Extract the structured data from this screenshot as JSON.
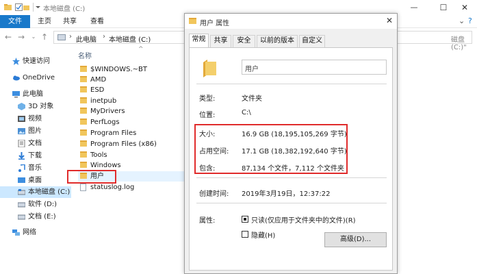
{
  "explorer": {
    "title": "本地磁盘 (C:)",
    "ribbon": {
      "file": "文件",
      "home": "主页",
      "share": "共享",
      "view": "查看"
    },
    "address": {
      "pc": "此电脑",
      "drive": "本地磁盘 (C:)",
      "search_placeholder": "磁盘 (C:)\""
    },
    "nav": {
      "quick_access": "快速访问",
      "onedrive": "OneDrive",
      "this_pc": "此电脑",
      "objects3d": "3D 对象",
      "videos": "视频",
      "pictures": "图片",
      "documents": "文档",
      "downloads": "下载",
      "music": "音乐",
      "desktop": "桌面",
      "drive_c": "本地磁盘 (C:)",
      "drive_d": "软件 (D:)",
      "drive_e": "文档 (E:)",
      "network": "网络"
    },
    "list": {
      "column_name": "名称",
      "items": [
        "$WINDOWS.~BT",
        "AMD",
        "ESD",
        "inetpub",
        "MyDrivers",
        "PerfLogs",
        "Program Files",
        "Program Files (x86)",
        "Tools",
        "Windows",
        "用户",
        "statuslog.log"
      ]
    }
  },
  "dialog": {
    "title": "用户 属性",
    "tabs": [
      "常规",
      "共享",
      "安全",
      "以前的版本",
      "自定义"
    ],
    "name_value": "用户",
    "type_label": "类型:",
    "type_value": "文件夹",
    "location_label": "位置:",
    "location_value": "C:\\",
    "size_label": "大小:",
    "size_value": "16.9 GB (18,195,105,269 字节)",
    "disk_size_label": "占用空间:",
    "disk_size_value": "17.1 GB (18,382,192,640 字节)",
    "contains_label": "包含:",
    "contains_value": "87,134 个文件，7,112 个文件夹",
    "created_label": "创建时间:",
    "created_value": "2019年3月19日，12:37:22",
    "attributes_label": "属性:",
    "readonly_label": "只读(仅应用于文件夹中的文件)(R)",
    "hidden_label": "隐藏(H)",
    "advanced_button": "高级(D)..."
  }
}
